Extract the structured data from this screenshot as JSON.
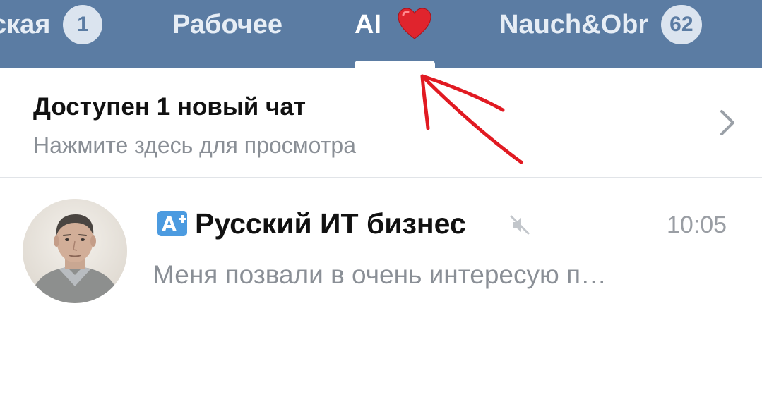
{
  "tabs": [
    {
      "label": "ская",
      "badge": "1"
    },
    {
      "label": "Рабочее"
    },
    {
      "label": "AI",
      "icon": "heart-icon",
      "active": true
    },
    {
      "label": "Nauch&Obr",
      "badge": "62"
    }
  ],
  "notice": {
    "title": "Доступен 1 новый чат",
    "subtitle": "Нажмите здесь для просмотра",
    "icon": "chevron-right-icon"
  },
  "chats": [
    {
      "name": "Русский ИТ бизнес",
      "badge_icon": "a-plus-icon",
      "muted": true,
      "time": "10:05",
      "preview": "Меня позвали в очень интересую п…"
    }
  ],
  "colors": {
    "tabbar": "#5b7ca3",
    "badge_bg": "#dbe4ef",
    "heart": "#e0242d",
    "annotation": "#e11a22",
    "a_plus_badge": "#4c9be0"
  }
}
